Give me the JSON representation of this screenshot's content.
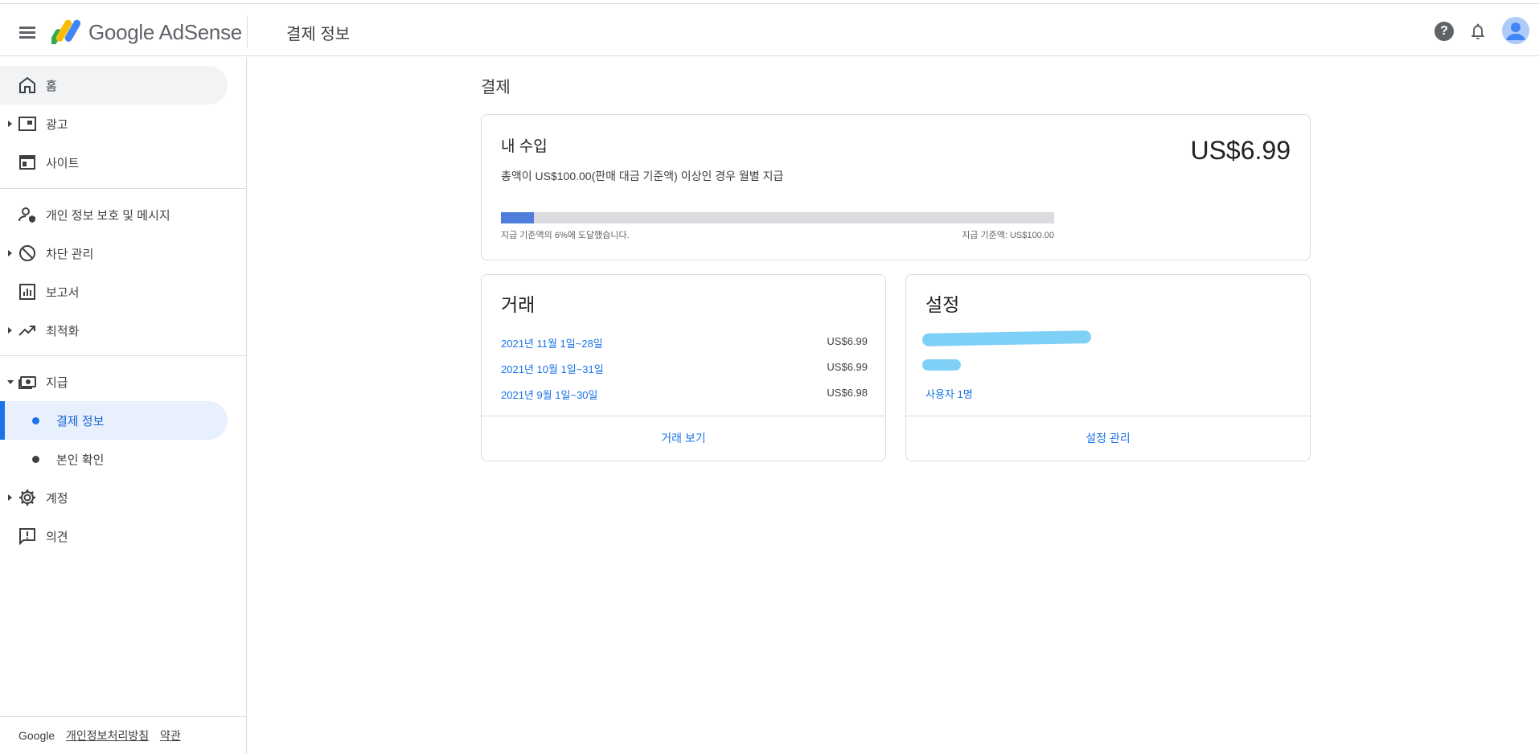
{
  "header": {
    "app_name": "Google AdSense",
    "page_title": "결제 정보"
  },
  "sidebar": {
    "items": [
      {
        "label": "홈"
      },
      {
        "label": "광고"
      },
      {
        "label": "사이트"
      },
      {
        "label": "개인 정보 보호 및 메시지"
      },
      {
        "label": "차단 관리"
      },
      {
        "label": "보고서"
      },
      {
        "label": "최적화"
      },
      {
        "label": "지급"
      },
      {
        "label": "결제 정보"
      },
      {
        "label": "본인 확인"
      },
      {
        "label": "계정"
      },
      {
        "label": "의견"
      }
    ],
    "footer": {
      "brand": "Google",
      "privacy": "개인정보처리방침",
      "terms": "약관"
    }
  },
  "main": {
    "section_title": "결제",
    "earnings": {
      "title": "내 수입",
      "amount": "US$6.99",
      "description": "총액이 US$100.00(판매 대금 기준액) 이상인 경우 월별 지급",
      "progress_fraction": 0.06,
      "progress_left_text": "지급 기준액의 6%에 도달했습니다.",
      "progress_right_text": "지급 기준액: US$100.00"
    },
    "transactions": {
      "title": "거래",
      "rows": [
        {
          "period": "2021년 11월 1일~28일",
          "amount": "US$6.99"
        },
        {
          "period": "2021년 10월 1일~31일",
          "amount": "US$6.99"
        },
        {
          "period": "2021년 9월 1일~30일",
          "amount": "US$6.98"
        }
      ],
      "action": "거래 보기"
    },
    "settings": {
      "title": "설정",
      "users_link": "사용자 1명",
      "action": "설정 관리"
    }
  },
  "colors": {
    "accent": "#1a73e8",
    "progress": "#4f7ddb",
    "redaction": "#7fd0f7"
  }
}
